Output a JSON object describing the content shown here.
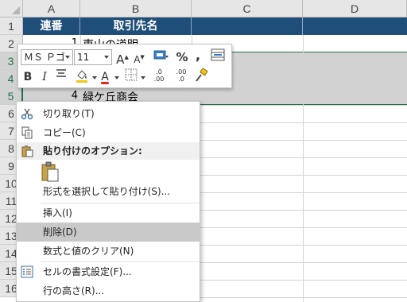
{
  "columns": [
    "A",
    "B",
    "C",
    "D"
  ],
  "rows": [
    "1",
    "2",
    "3",
    "4",
    "5",
    "6",
    "7",
    "8",
    "9",
    "10",
    "11",
    "12",
    "13",
    "14",
    "15",
    "16"
  ],
  "header_cells": {
    "a1": "連番",
    "b1": "取引先名"
  },
  "cells": {
    "a2": "1",
    "b2": "東山の道明",
    "a5": "4",
    "b5": "緑ケ丘商会"
  },
  "mini_toolbar": {
    "font_name": "ＭＳ Ｐゴ",
    "font_size": "11",
    "grow_font": "A",
    "shrink_font": "A",
    "percent": "%",
    "comma": ",",
    "bold": "B",
    "italic": "I",
    "font_color_letter": "A",
    "inc_decimal": ".0 .00",
    "dec_decimal": ".00 .0"
  },
  "context_menu": {
    "cut": "切り取り(T)",
    "copy": "コピー(C)",
    "paste_options": "貼り付けのオプション:",
    "paste_special": "形式を選択して貼り付け(S)...",
    "insert": "挿入(I)",
    "delete": "削除(D)",
    "clear_contents": "数式と値のクリア(N)",
    "format_cells": "セルの書式設定(F)...",
    "row_height": "行の高さ(R)..."
  },
  "colors": {
    "header_fill": "#1f4e79",
    "selection_band": "#d2d2d2",
    "excel_green": "#217346",
    "menu_highlight": "#c9c9c9"
  },
  "icons": [
    "scissors-icon",
    "copy-icon",
    "paste-icon",
    "clipboard-paste-icon",
    "format-cells-icon",
    "format-painter-icon",
    "borders-icon",
    "fill-color-icon",
    "align-icon",
    "accounting-format-icon",
    "merge-icon"
  ]
}
